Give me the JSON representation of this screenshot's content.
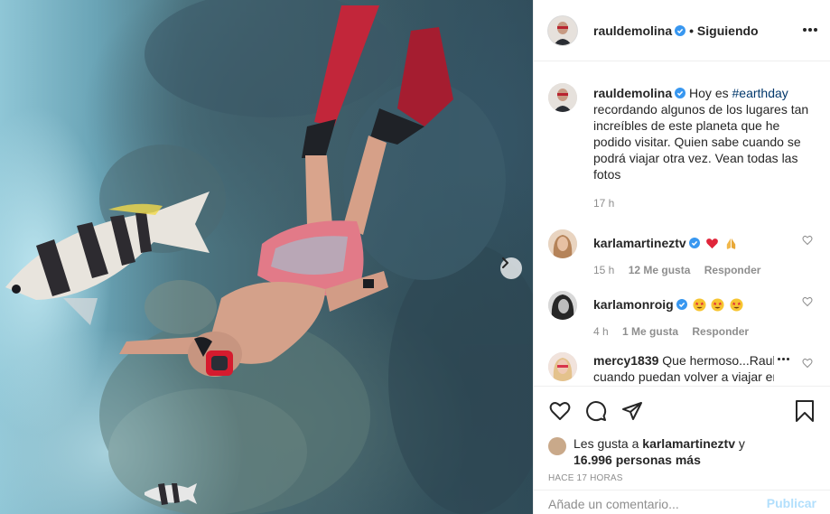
{
  "post": {
    "author": "rauldemolina",
    "follow_status": "• Siguiendo",
    "caption_prefix": "Hoy es",
    "hashtag": "#earthday",
    "caption_rest": "recordando algunos de los lugares tan increíbles de este planeta que he podido visitar. Quien sabe cuando se podrá viajar otra vez. Vean todas las fotos",
    "time": "17 h",
    "likes_prefix": "Les gusta a",
    "likes_user": "karlamartineztv",
    "likes_and": "y",
    "likes_others": "16.996 personas más",
    "timestamp": "HACE 17 HORAS"
  },
  "comments": [
    {
      "user": "karlamartineztv",
      "verified": true,
      "text": "",
      "emojis": [
        "red-heart",
        "folded-hands"
      ],
      "time": "15 h",
      "likes": "12 Me gusta",
      "reply": "Responder"
    },
    {
      "user": "karlamonroig",
      "verified": true,
      "text": "",
      "emojis": [
        "star-struck",
        "star-struck",
        "star-struck"
      ],
      "time": "4 h",
      "likes": "1 Me gusta",
      "reply": "Responder"
    },
    {
      "user": "mercy1839",
      "verified": false,
      "text": "Que hermoso...Raul",
      "text2": "cuando puedan volver a viajar en"
    }
  ],
  "add_comment": {
    "placeholder": "Añade un comentario...",
    "publish": "Publicar"
  },
  "colors": {
    "accent": "#0095f6",
    "verified": "#3897f0",
    "hashtag": "#00376b",
    "muted": "#8e8e8e"
  }
}
